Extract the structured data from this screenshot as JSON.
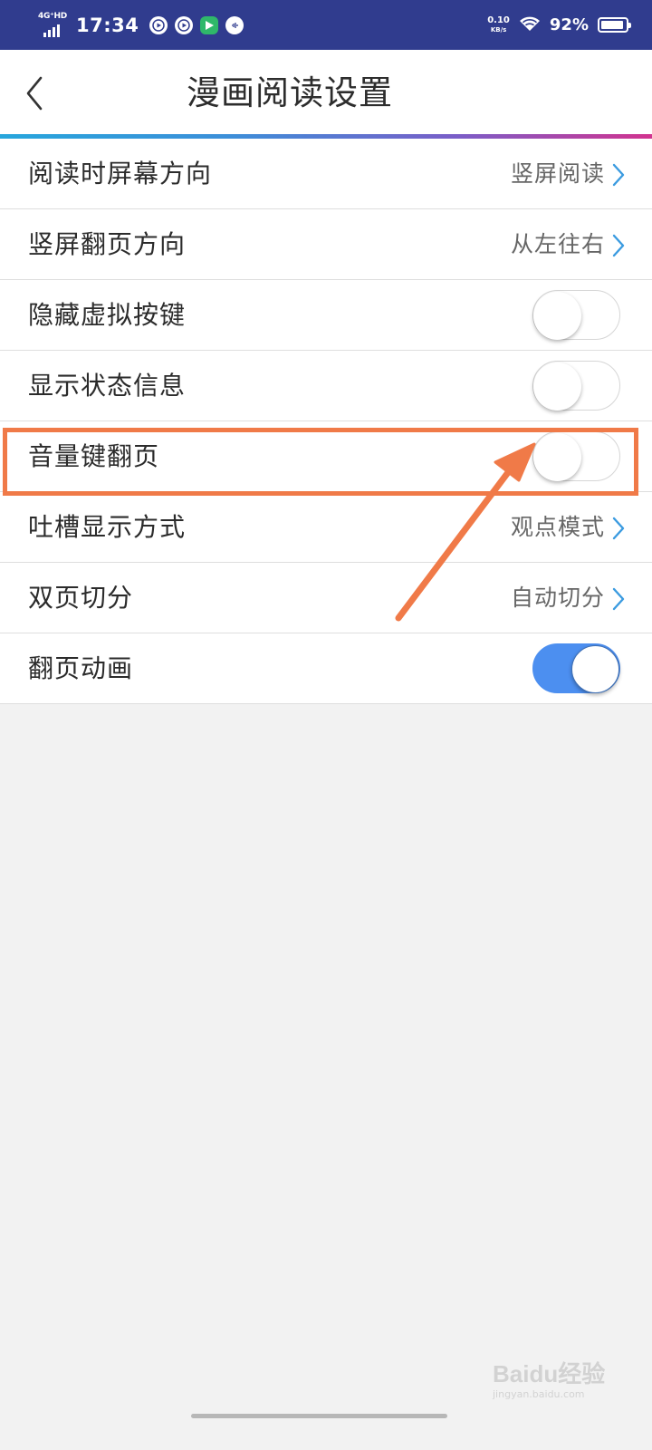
{
  "status_bar": {
    "network": "4G⁺HD",
    "time": "17:34",
    "speed_value": "0.10",
    "speed_unit": "KB/s",
    "battery_percent": "92%",
    "battery_level": 0.92
  },
  "header": {
    "title": "漫画阅读设置",
    "back_icon": "chevron-left-icon"
  },
  "settings": [
    {
      "label": "阅读时屏幕方向",
      "value": "竖屏阅读"
    },
    {
      "label": "竖屏翻页方向",
      "value": "从左往右"
    },
    {
      "label": "隐藏虚拟按键",
      "toggle": false
    },
    {
      "label": "显示状态信息",
      "toggle": false
    },
    {
      "label": "音量键翻页",
      "toggle": false
    },
    {
      "label": "吐槽显示方式",
      "value": "观点模式"
    },
    {
      "label": "双页切分",
      "value": "自动切分"
    },
    {
      "label": "翻页动画",
      "toggle": true
    }
  ],
  "colors": {
    "status_bar": "#303c8e",
    "toggle_on": "#4c8ff0",
    "chevron": "#3b9be0",
    "annotation": "#f07a48"
  },
  "watermark": {
    "logo": "Baidu经验",
    "url": "jingyan.baidu.com"
  }
}
